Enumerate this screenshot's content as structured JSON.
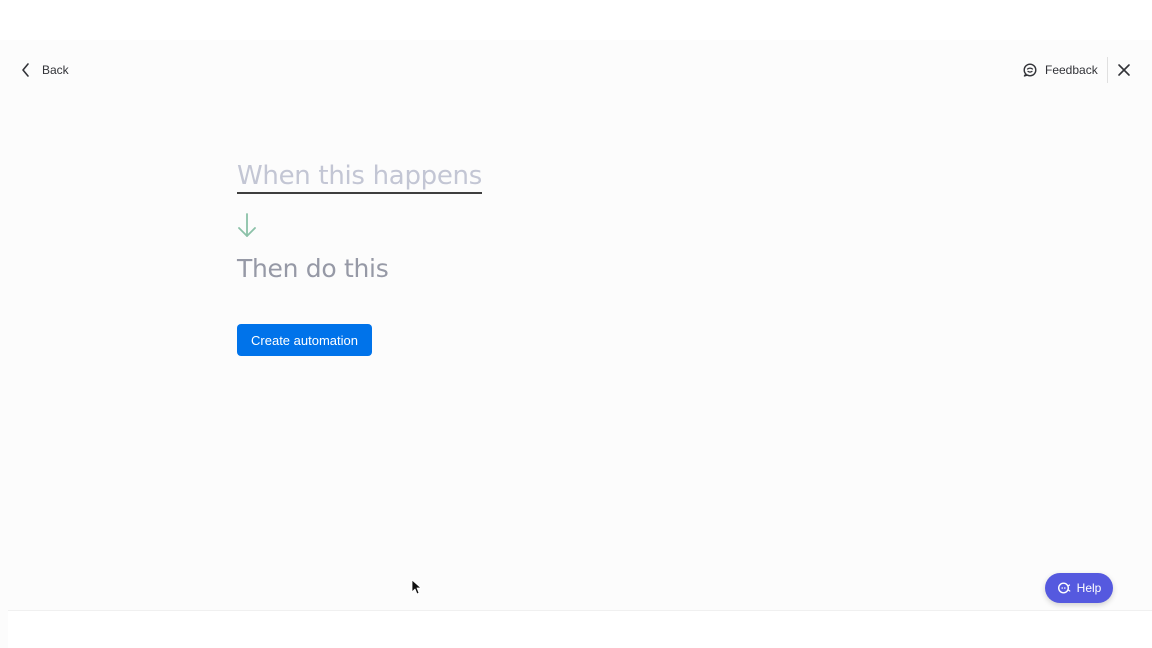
{
  "header": {
    "back_label": "Back",
    "feedback_label": "Feedback",
    "icons": {
      "back": "chevron-left-icon",
      "feedback": "chat-bubble-icon",
      "close": "close-icon"
    }
  },
  "recipe": {
    "trigger_label": "When this happens",
    "action_label": "Then do this",
    "arrow_icon": "arrow-down-icon"
  },
  "actions": {
    "create_label": "Create automation"
  },
  "help": {
    "label": "Help",
    "icon": "chat-help-icon"
  },
  "colors": {
    "primary": "#0073ea",
    "help": "#5559df",
    "arrow": "#8bc1a8",
    "trigger_text": "#c3c6d4",
    "action_text": "#9699a6"
  }
}
